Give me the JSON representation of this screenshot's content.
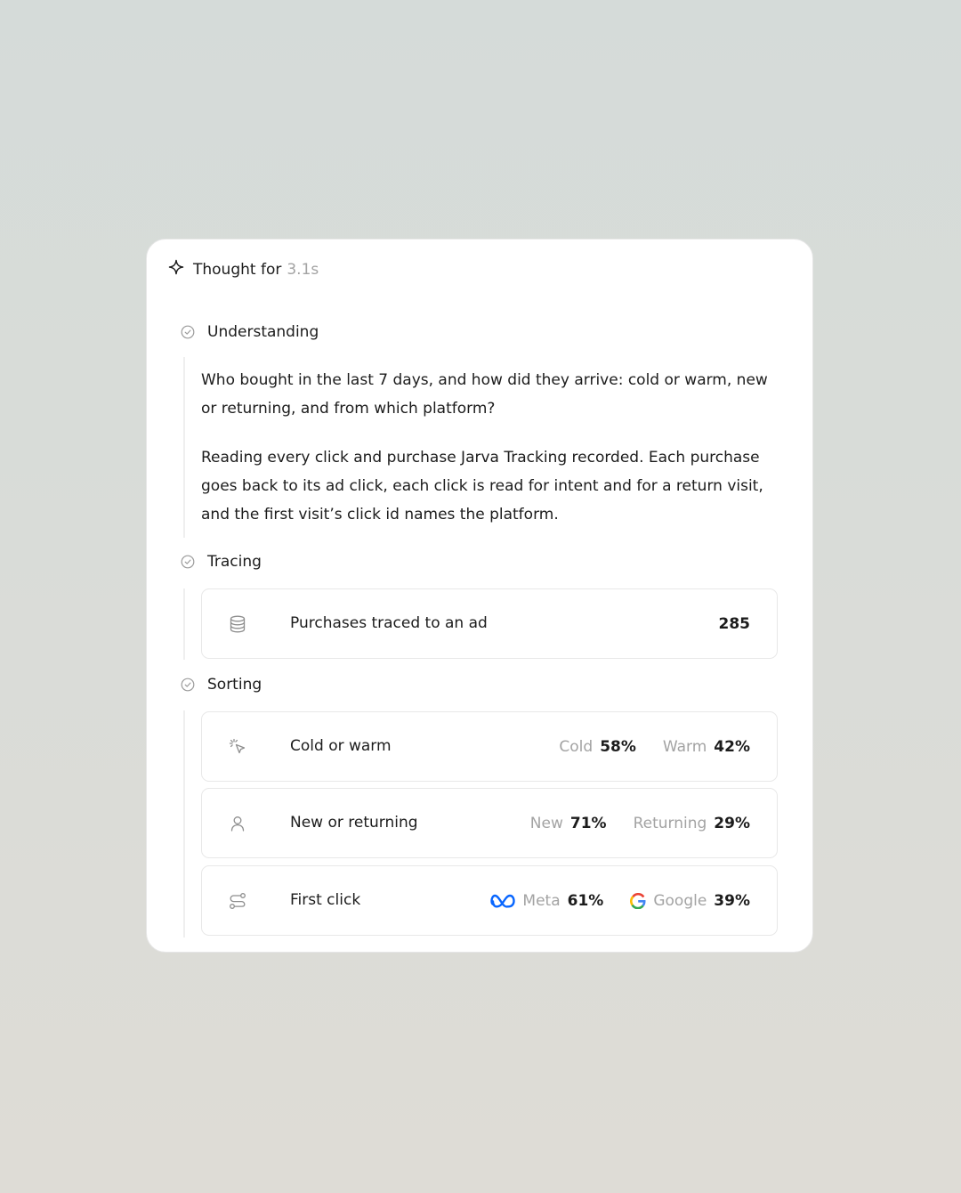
{
  "header": {
    "title": "Thought for",
    "duration": "3.1s",
    "icon": "sparkle-icon"
  },
  "steps": [
    {
      "label": "Understanding",
      "status_icon": "check-circle-icon",
      "paragraphs": [
        "Who bought in the last 7 days, and how did they arrive: cold or warm, new or returning, and from which platform?",
        "Reading every click and purchase Jarva Tracking recorded. Each purchase goes back to its ad click, each click is read for intent and for a return visit, and the first visit’s click id names the platform."
      ]
    },
    {
      "label": "Tracing",
      "status_icon": "check-circle-icon",
      "rows": [
        {
          "icon": "database-icon",
          "name": "Purchases traced to an ad",
          "value": "285"
        }
      ]
    },
    {
      "label": "Sorting",
      "status_icon": "check-circle-icon",
      "rows": [
        {
          "icon": "cursor-click-icon",
          "name": "Cold or warm",
          "stats": [
            {
              "label": "Cold",
              "value": "58%"
            },
            {
              "label": "Warm",
              "value": "42%"
            }
          ]
        },
        {
          "icon": "user-icon",
          "name": "New or returning",
          "stats": [
            {
              "label": "New",
              "value": "71%"
            },
            {
              "label": "Returning",
              "value": "29%"
            }
          ]
        },
        {
          "icon": "route-icon",
          "name": "First click",
          "stats": [
            {
              "label": "Meta",
              "value": "61%",
              "icon": "meta-logo-icon"
            },
            {
              "label": "Google",
              "value": "39%",
              "icon": "google-logo-icon"
            }
          ]
        }
      ]
    }
  ],
  "colors": {
    "text": "#1c1c1c",
    "muted": "#a3a3a3",
    "meta_blue": "#0866ff",
    "google_blue": "#4285f4",
    "google_red": "#ea4335",
    "google_yellow": "#fbbc05",
    "google_green": "#34a853"
  }
}
